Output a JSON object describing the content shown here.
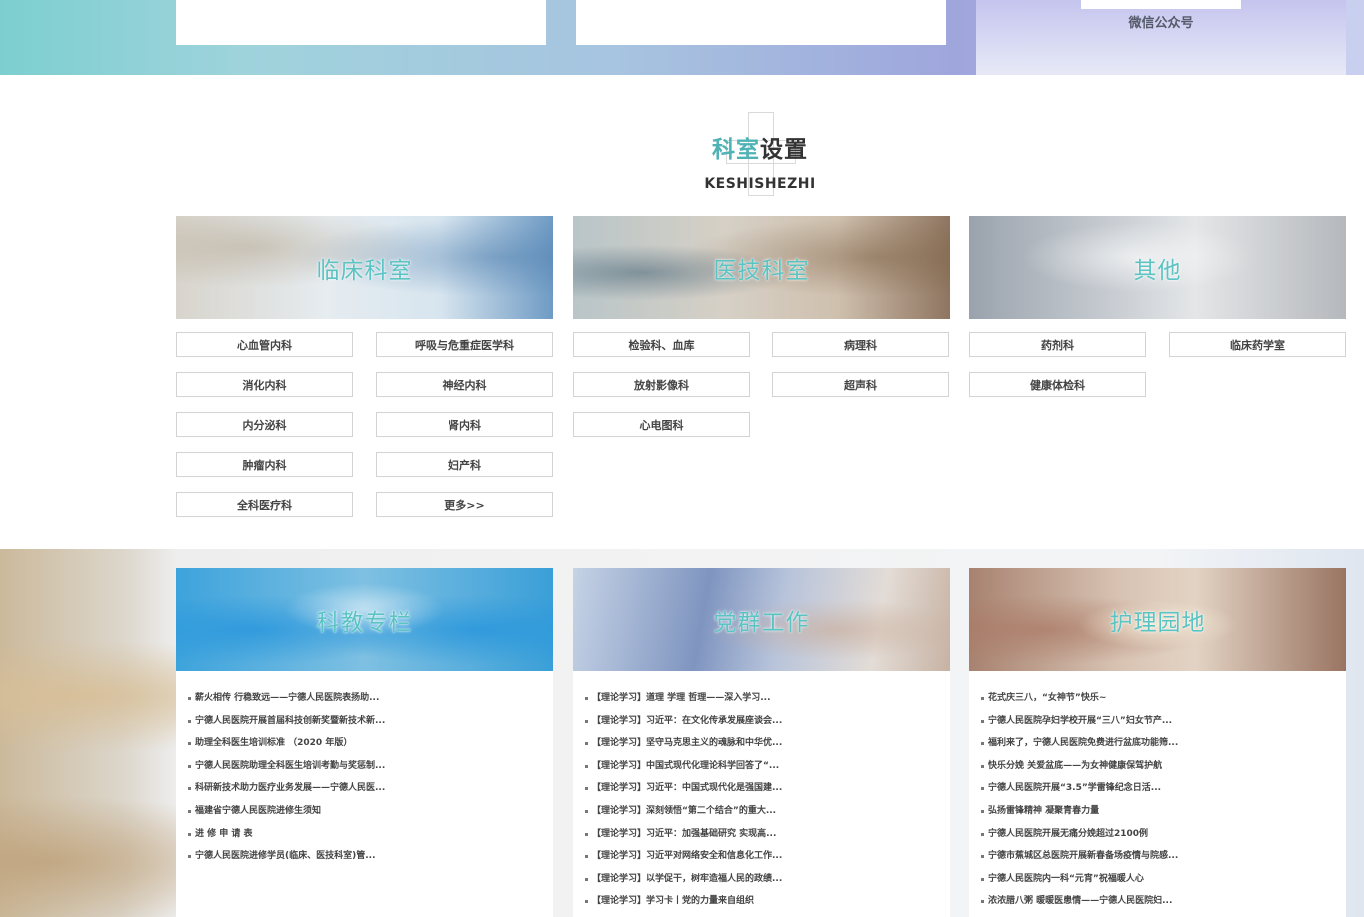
{
  "top": {
    "wechat_label": "微信公众号"
  },
  "section": {
    "title_accent": "科室",
    "title_rest": "设置",
    "subtitle": "KESHISHEZHI"
  },
  "departments": [
    {
      "title": "临床科室",
      "items": [
        "心血管内科",
        "呼吸与危重症医学科",
        "消化内科",
        "神经内科",
        "内分泌科",
        "肾内科",
        "肿瘤内科",
        "妇产科",
        "全科医疗科",
        "更多>>"
      ]
    },
    {
      "title": "医技科室",
      "items": [
        "检验科、血库",
        "病理科",
        "放射影像科",
        "超声科",
        "心电图科"
      ]
    },
    {
      "title": "其他",
      "items": [
        "药剂科",
        "临床药学室",
        "健康体检科"
      ]
    }
  ],
  "news_columns": [
    {
      "title": "科教专栏",
      "items": [
        "薪火相传 行稳致远——宁德人民医院表扬助...",
        "宁德人民医院开展首届科技创新奖暨新技术新...",
        "助理全科医生培训标准 （2020 年版）",
        "宁德人民医院助理全科医生培训考勤与奖惩制...",
        "科研新技术助力医疗业务发展——宁德人民医...",
        "福建省宁德人民医院进修生须知",
        "进 修 申 请 表",
        "宁德人民医院进修学员(临床、医技科室)管..."
      ]
    },
    {
      "title": "党群工作",
      "items": [
        "【理论学习】道理 学理 哲理——深入学习...",
        "【理论学习】习近平：在文化传承发展座谈会...",
        "【理论学习】坚守马克思主义的魂脉和中华优...",
        "【理论学习】中国式现代化理论科学回答了“...",
        "【理论学习】习近平：中国式现代化是强国建...",
        "【理论学习】深刻领悟“第二个结合”的重大...",
        "【理论学习】习近平：加强基础研究 实现高...",
        "【理论学习】习近平对网络安全和信息化工作...",
        "【理论学习】以学促干，树牢造福人民的政绩...",
        "【理论学习】学习卡丨党的力量来自组织"
      ]
    },
    {
      "title": "护理园地",
      "items": [
        "花式庆三八，“女神节”快乐~",
        "宁德人民医院孕妇学校开展“三八”妇女节产...",
        "福利来了，宁德人民医院免费进行盆底功能筛...",
        "快乐分娩 关爱盆底——为女神健康保驾护航",
        "宁德人民医院开展“3.5”学雷锋纪念日活...",
        "弘扬雷锋精神 凝聚青春力量",
        "宁德人民医院开展无痛分娩超过2100例",
        "宁德市蕉城区总医院开展新春备场疫情与院感...",
        "宁德人民医院内一科“元宵”祝福暖人心",
        "浓浓腊八粥 暖暖医患情——宁德人民医院妇..."
      ]
    }
  ]
}
